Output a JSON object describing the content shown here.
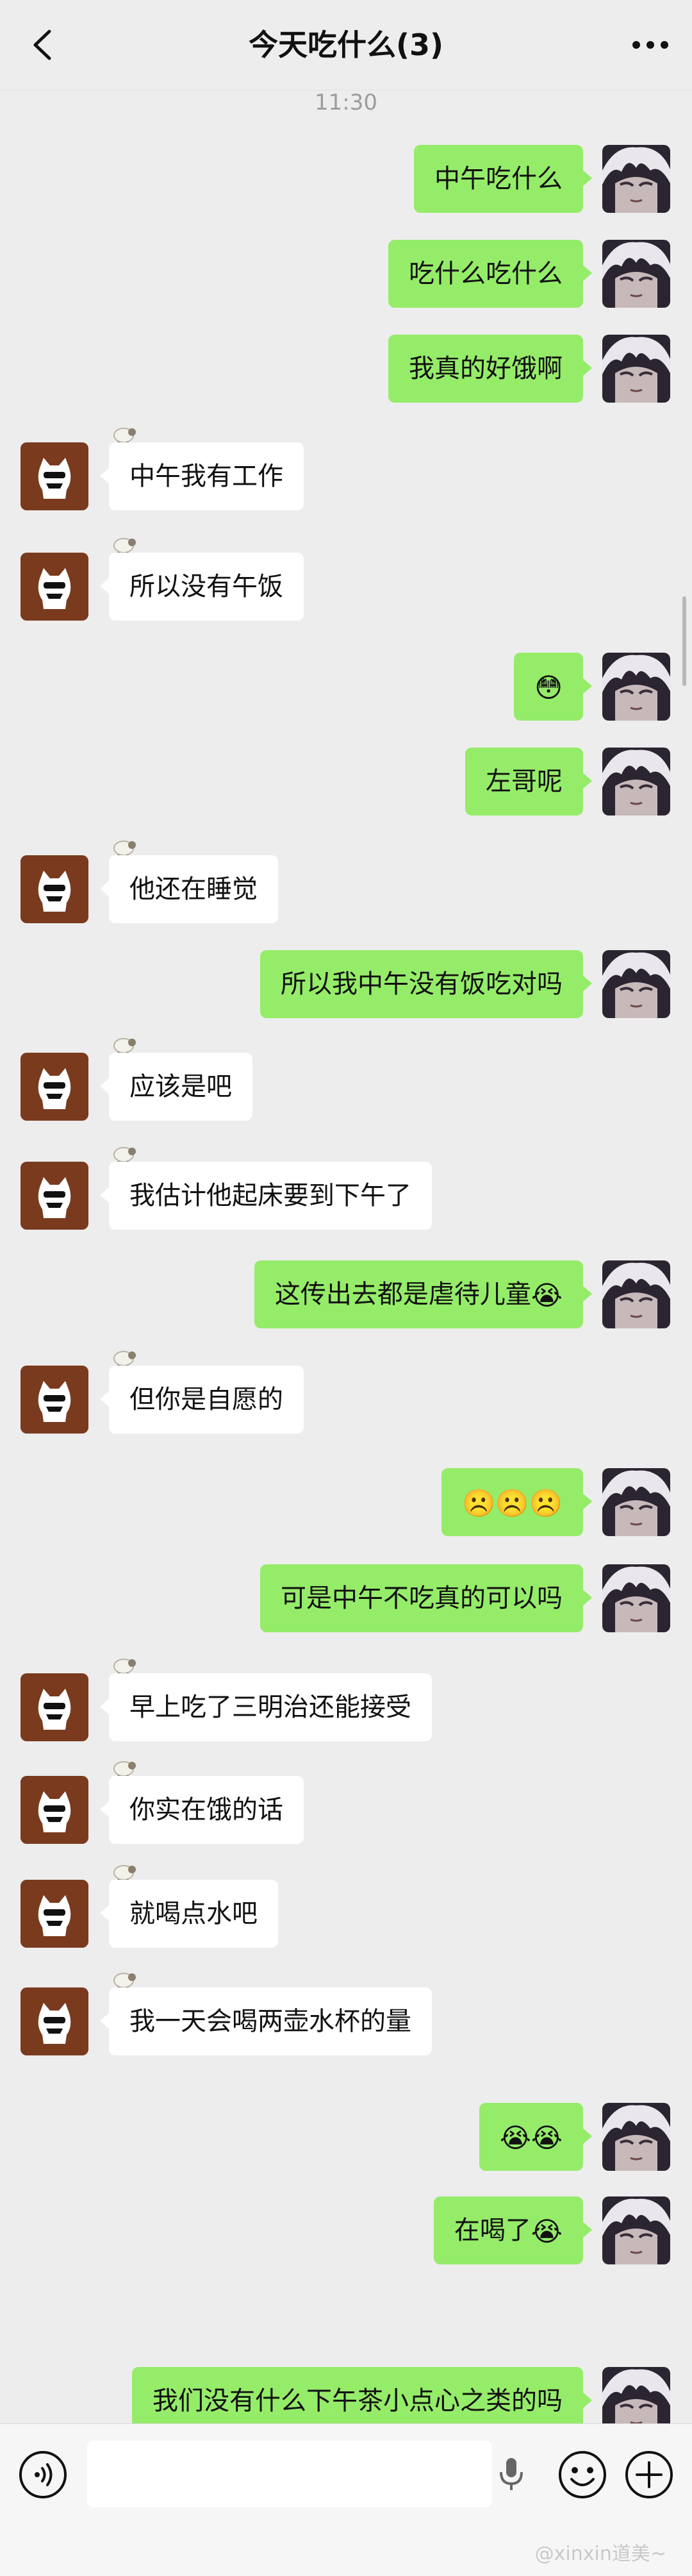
{
  "header": {
    "title": "今天吃什么(3)"
  },
  "time_divider": "11:30",
  "messages": [
    {
      "side": "me",
      "text": "中午吃什么",
      "emoji": ""
    },
    {
      "side": "me",
      "text": "吃什么吃什么",
      "emoji": ""
    },
    {
      "side": "me",
      "text": "我真的好饿啊",
      "emoji": ""
    },
    {
      "side": "other",
      "text": "中午我有工作",
      "emoji": ""
    },
    {
      "side": "other",
      "text": "所以没有午饭",
      "emoji": ""
    },
    {
      "side": "me",
      "text": "",
      "emoji": "😳"
    },
    {
      "side": "me",
      "text": "左哥呢",
      "emoji": ""
    },
    {
      "side": "other",
      "text": "他还在睡觉",
      "emoji": ""
    },
    {
      "side": "me",
      "text": "所以我中午没有饭吃对吗",
      "emoji": ""
    },
    {
      "side": "other",
      "text": "应该是吧",
      "emoji": ""
    },
    {
      "side": "other",
      "text": "我估计他起床要到下午了",
      "emoji": ""
    },
    {
      "side": "me",
      "text": "这传出去都是虐待儿童",
      "emoji": "😭"
    },
    {
      "side": "other",
      "text": "但你是自愿的",
      "emoji": ""
    },
    {
      "side": "me",
      "text": "",
      "emoji": "☹️☹️☹️"
    },
    {
      "side": "me",
      "text": "可是中午不吃真的可以吗",
      "emoji": ""
    },
    {
      "side": "other",
      "text": "早上吃了三明治还能接受",
      "emoji": ""
    },
    {
      "side": "other",
      "text": "你实在饿的话",
      "emoji": ""
    },
    {
      "side": "other",
      "text": "就喝点水吧",
      "emoji": ""
    },
    {
      "side": "other",
      "text": "我一天会喝两壶水杯的量",
      "emoji": ""
    },
    {
      "side": "me",
      "text": "",
      "emoji": "😭😭"
    },
    {
      "side": "me",
      "text": "在喝了",
      "emoji": "😭"
    },
    {
      "side": "me",
      "text": "我们没有什么下午茶小点心之类的吗",
      "emoji": ""
    }
  ],
  "watermark": "@xinxin道美~",
  "icons": {
    "back": "chevron-left-icon",
    "more": "more-dots-icon",
    "voice": "voice-icon",
    "mic": "mic-icon",
    "emoji": "smile-icon",
    "plus": "plus-icon",
    "group_tag": "sheep-icon"
  },
  "colors": {
    "my_bubble": "#95ec69",
    "other_bubble": "#ffffff",
    "background": "#ededed"
  }
}
